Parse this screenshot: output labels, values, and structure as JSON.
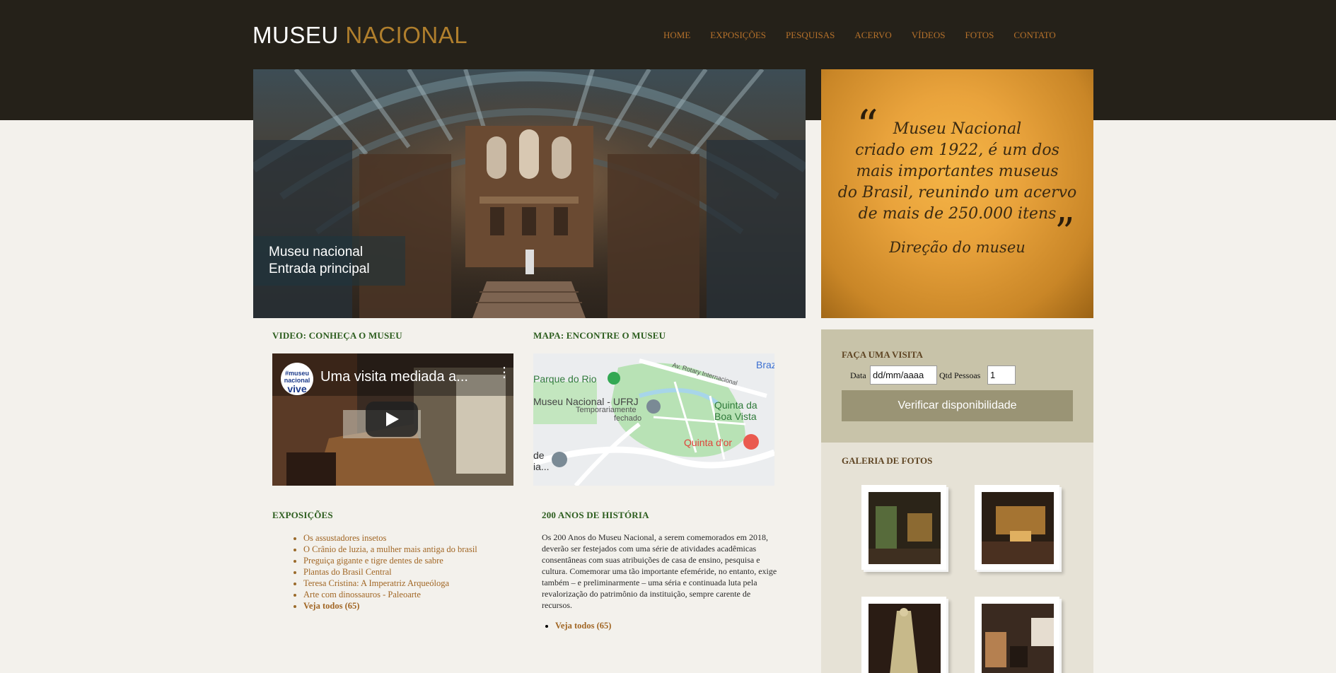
{
  "header": {
    "logo_word1": "MUSEU",
    "logo_word2": "NACIONAL",
    "nav": [
      "HOME",
      "EXPOSIÇÕES",
      "PESQUISAS",
      "ACERVO",
      "VÍDEOS",
      "FOTOS",
      "CONTATO"
    ]
  },
  "hero": {
    "caption_line1": "Museu nacional",
    "caption_line2": "Entrada principal"
  },
  "quote": {
    "line1": "Museu Nacional",
    "line2": "criado em 1922, é um dos",
    "line3": "mais importantes museus",
    "line4": "do Brasil, reunindo um acervo",
    "line5": "de mais de 250.000 itens",
    "signature": "Direção do museu"
  },
  "video_section": {
    "title": "VIDEO: CONHEÇA O MUSEU",
    "video_title": "Uma visita mediada a...",
    "channel_logo_line1": "#museu",
    "channel_logo_line2": "nacional",
    "channel_logo_line3": "vive"
  },
  "map_section": {
    "title": "MAPA: ENCONTRE O MUSEU",
    "labels": {
      "parque": "Parque do Rio",
      "museu": "Museu Nacional - UFRJ",
      "temp": "Temporariamente",
      "fechado": "fechado",
      "quinta": "Quinta da",
      "boa_vista": "Boa Vista",
      "quinta_dor": "Quinta d'or",
      "braz": "Braz",
      "avenida": "Av. Rotary Internacional",
      "de": "de",
      "ia": "ia..."
    }
  },
  "exposicoes": {
    "title": "EXPOSIÇÕES",
    "items": [
      "Os assustadores insetos",
      "O Crânio de luzia, a mulher mais antiga do brasil",
      "Preguiça gigante e tigre dentes de sabre",
      "Plantas do Brasil Central",
      "Teresa Cristina: A Imperatriz Arqueóloga",
      "Arte com dinossauros - Paleoarte"
    ],
    "see_all": "Veja todos (65)"
  },
  "historia": {
    "title": "200 ANOS DE HISTÓRIA",
    "text": "Os 200 Anos do Museu Nacional, a serem comemorados em 2018, deverão ser festejados com uma série de atividades acadêmicas consentâneas com suas atribuições de casa de ensino, pesquisa e cultura. Comemorar uma tão importante efeméride, no entanto, exige também – e preliminarmente – uma séria e continuada luta pela revalorização do patrimônio da instituição, sempre carente de recursos.",
    "see_all": "Veja todos (65)"
  },
  "visita": {
    "title": "FAÇA UMA VISITA",
    "date_label": "Data",
    "date_value": "dd/mm/aaaa",
    "qty_label": "Qtd Pessoas",
    "qty_value": "1",
    "button": "Verificar disponibilidade"
  },
  "galeria": {
    "title": "GALERIA DE FOTOS"
  },
  "colors": {
    "header_bg": "#252119",
    "accent": "#b07f2d",
    "nav_link": "#b5712b",
    "section_title_green": "#2c5d1e",
    "sidebar_title_brown": "#5f4523",
    "button_bg": "#9a9475"
  }
}
